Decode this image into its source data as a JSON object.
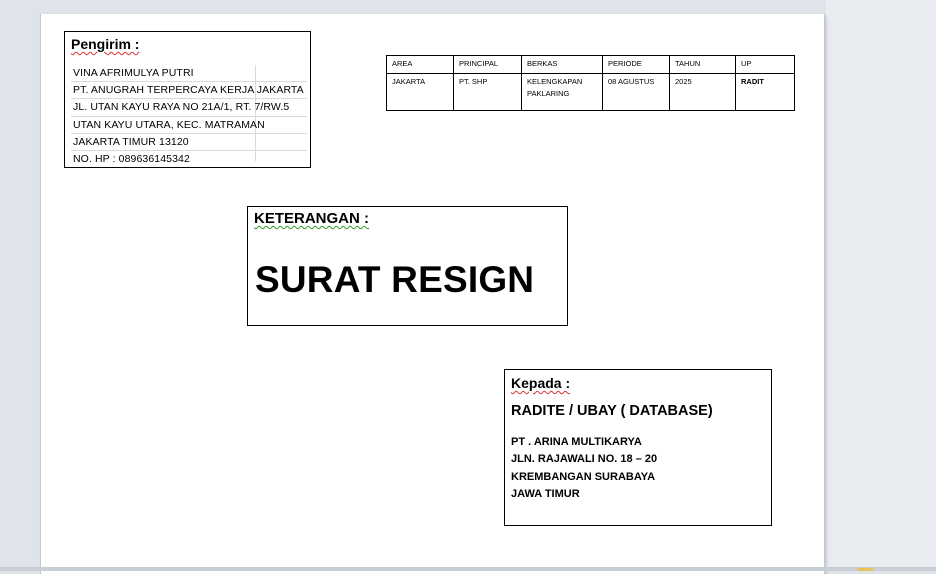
{
  "sender": {
    "title": "Pengirim :",
    "lines": [
      "VINA AFRIMULYA PUTRI",
      "PT. ANUGRAH TERPERCAYA KERJA JAKARTA",
      "JL. UTAN KAYU RAYA NO 21A/1, RT. 7/RW.5",
      "UTAN KAYU UTARA, KEC. MATRAMAN",
      "JAKARTA TIMUR 13120",
      "NO. HP : 089636145342"
    ]
  },
  "info_table": {
    "headers": [
      "AREA",
      "PRINCIPAL",
      "BERKAS",
      "PERIODE",
      "TAHUN",
      "UP"
    ],
    "values": [
      "JAKARTA",
      "PT. SHP",
      "KELENGKAPAN PAKLARING",
      "08 AGUSTUS",
      "2025",
      "RADIT"
    ]
  },
  "keterangan": {
    "label": "KETERANGAN :",
    "text": "SURAT RESIGN"
  },
  "kepada": {
    "label": "Kepada :",
    "recipient": "RADITE / UBAY ( DATABASE)",
    "address": [
      "PT . ARINA MULTIKARYA",
      "JLN. RAJAWALI NO. 18 – 20",
      "KREMBANGAN SURABAYA",
      "JAWA TIMUR"
    ]
  }
}
